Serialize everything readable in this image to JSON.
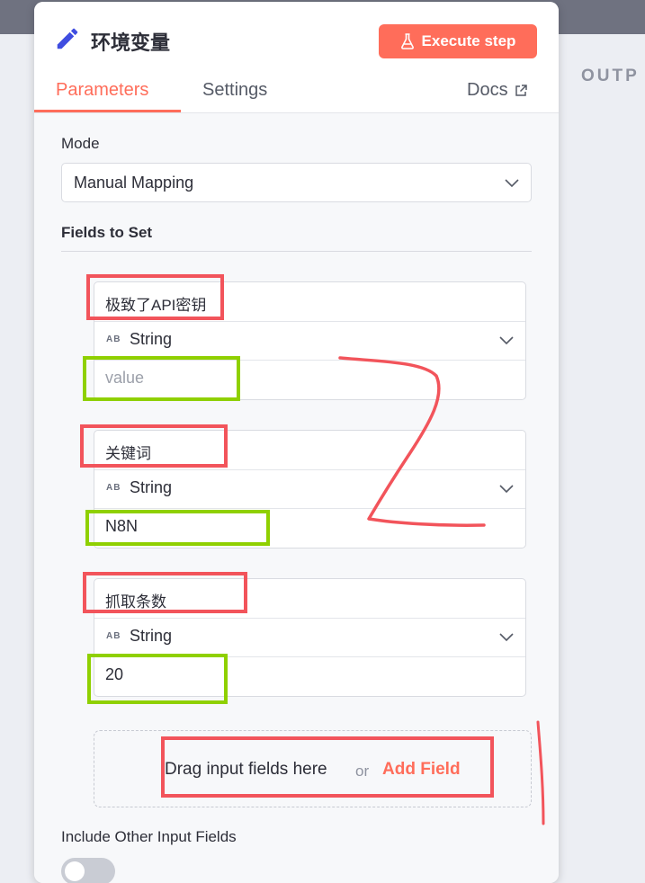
{
  "node": {
    "title": "环境变量",
    "execute_label": "Execute step"
  },
  "tabs": {
    "parameters": "Parameters",
    "settings": "Settings",
    "docs": "Docs"
  },
  "output_label": "OUTP",
  "mode": {
    "label": "Mode",
    "value": "Manual Mapping"
  },
  "fields_section_label": "Fields to Set",
  "fields": [
    {
      "name": "极致了API密钥",
      "type": "String",
      "value": "",
      "placeholder": "value"
    },
    {
      "name": "关键词",
      "type": "String",
      "value": "N8N",
      "placeholder": ""
    },
    {
      "name": "抓取条数",
      "type": "String",
      "value": "20",
      "placeholder": ""
    }
  ],
  "type_icon_text": "AB",
  "dropzone": {
    "text": "Drag input fields here",
    "or": "or",
    "add_field": "Add Field"
  },
  "include_other": {
    "label": "Include Other Input Fields",
    "enabled": false
  },
  "colors": {
    "accent": "#ff6d5a",
    "annotation_red": "#f2545b",
    "annotation_green": "#8fd000"
  }
}
